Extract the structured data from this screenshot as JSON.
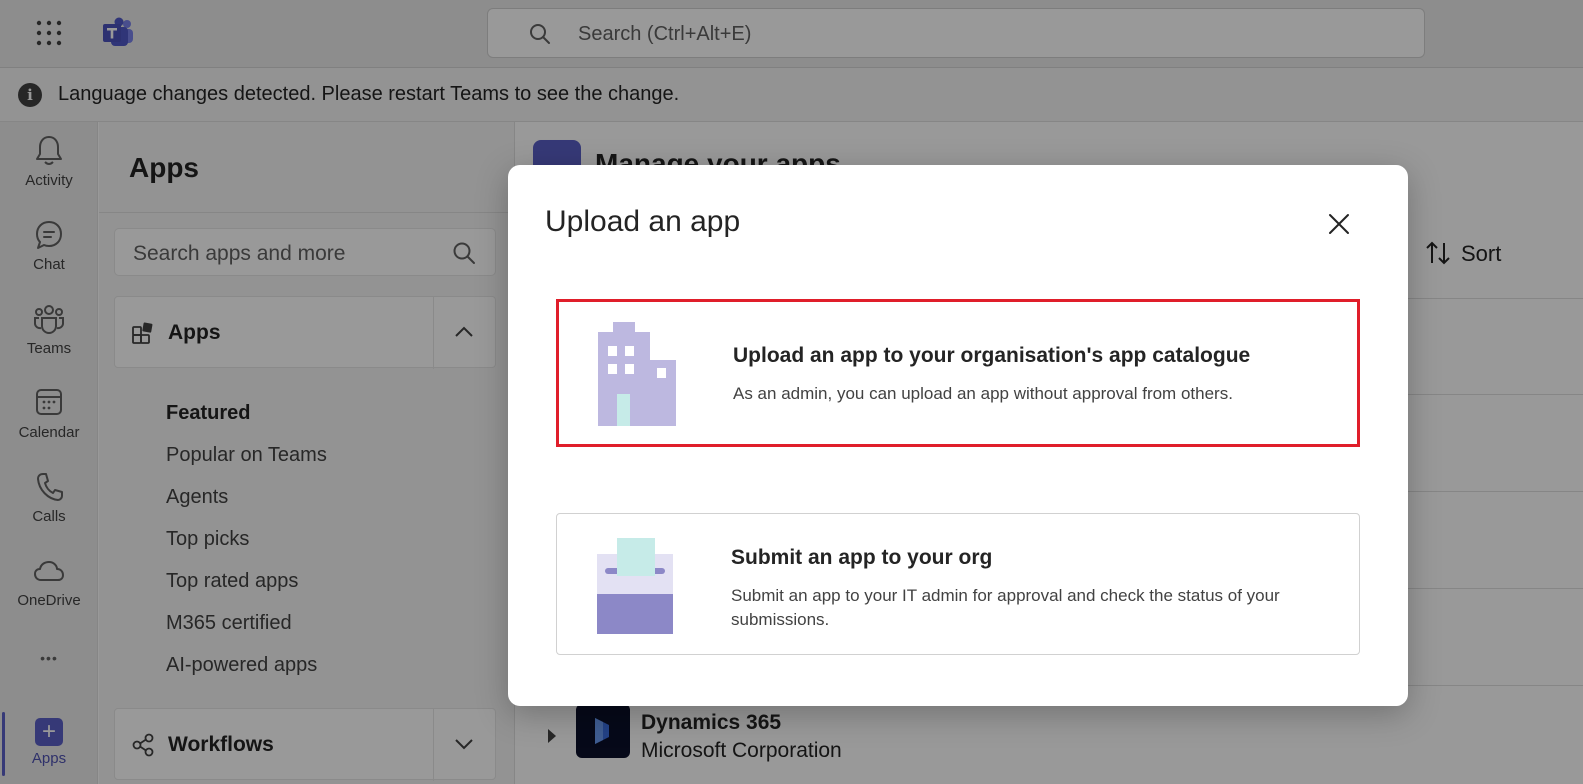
{
  "topbar": {
    "search_placeholder": "Search (Ctrl+Alt+E)"
  },
  "banner": {
    "info_glyph": "i",
    "message": "Language changes detected. Please restart Teams to see the change."
  },
  "rail": {
    "items": [
      {
        "label": "Activity",
        "icon": "bell-icon"
      },
      {
        "label": "Chat",
        "icon": "chat-icon"
      },
      {
        "label": "Teams",
        "icon": "teams-icon"
      },
      {
        "label": "Calendar",
        "icon": "calendar-icon"
      },
      {
        "label": "Calls",
        "icon": "phone-icon"
      },
      {
        "label": "OneDrive",
        "icon": "cloud-icon"
      },
      {
        "label": "Apps",
        "icon": "plus-icon",
        "active": true
      }
    ],
    "more_glyph": "•••",
    "apps_plus": "+"
  },
  "panel": {
    "title": "Apps",
    "search_placeholder": "Search apps and more",
    "apps_section": "Apps",
    "nav": [
      "Featured",
      "Popular on Teams",
      "Agents",
      "Top picks",
      "Top rated apps",
      "M365 certified",
      "AI-powered apps"
    ],
    "workflows_section": "Workflows"
  },
  "main": {
    "header_text": "Manage your apps",
    "sort_label": "Sort",
    "dynamics_name": "Dynamics 365",
    "dynamics_publisher": "Microsoft Corporation"
  },
  "dialog": {
    "title": "Upload an app",
    "option1": {
      "title": "Upload an app to your organisation's app catalogue",
      "desc": "As an admin, you can upload an app without approval from others."
    },
    "option2": {
      "title": "Submit an app to your org",
      "desc": "Submit an app to your IT admin for approval and check the status of your submissions."
    }
  },
  "colors": {
    "brand": "#5b5fc7",
    "highlight": "#e01e2a",
    "illustration_purple": "#bdb8e0",
    "illustration_teal": "#c6ebe8"
  }
}
